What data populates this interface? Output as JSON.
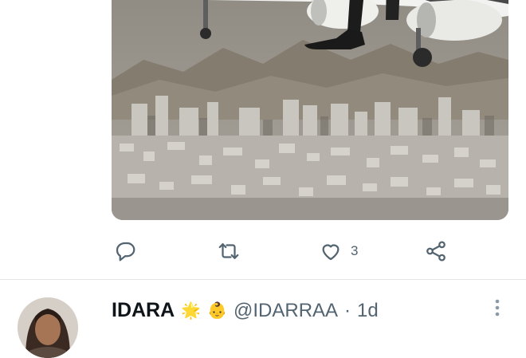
{
  "tweet": {
    "media": {
      "image": "photo of airplane landing low over a city with a person's legs and shoe hanging from the plane"
    },
    "actions": {
      "reply_icon": "reply-icon",
      "retweet_icon": "retweet-icon",
      "like_icon": "like-icon",
      "like_count": "3",
      "share_icon": "share-icon"
    }
  },
  "next_tweet": {
    "display_name": "IDARA",
    "name_emojis": [
      "🌟",
      "👶"
    ],
    "handle": "@IDARRAA",
    "separator": "·",
    "timestamp": "1d",
    "more_icon": "more-vertical-icon"
  }
}
